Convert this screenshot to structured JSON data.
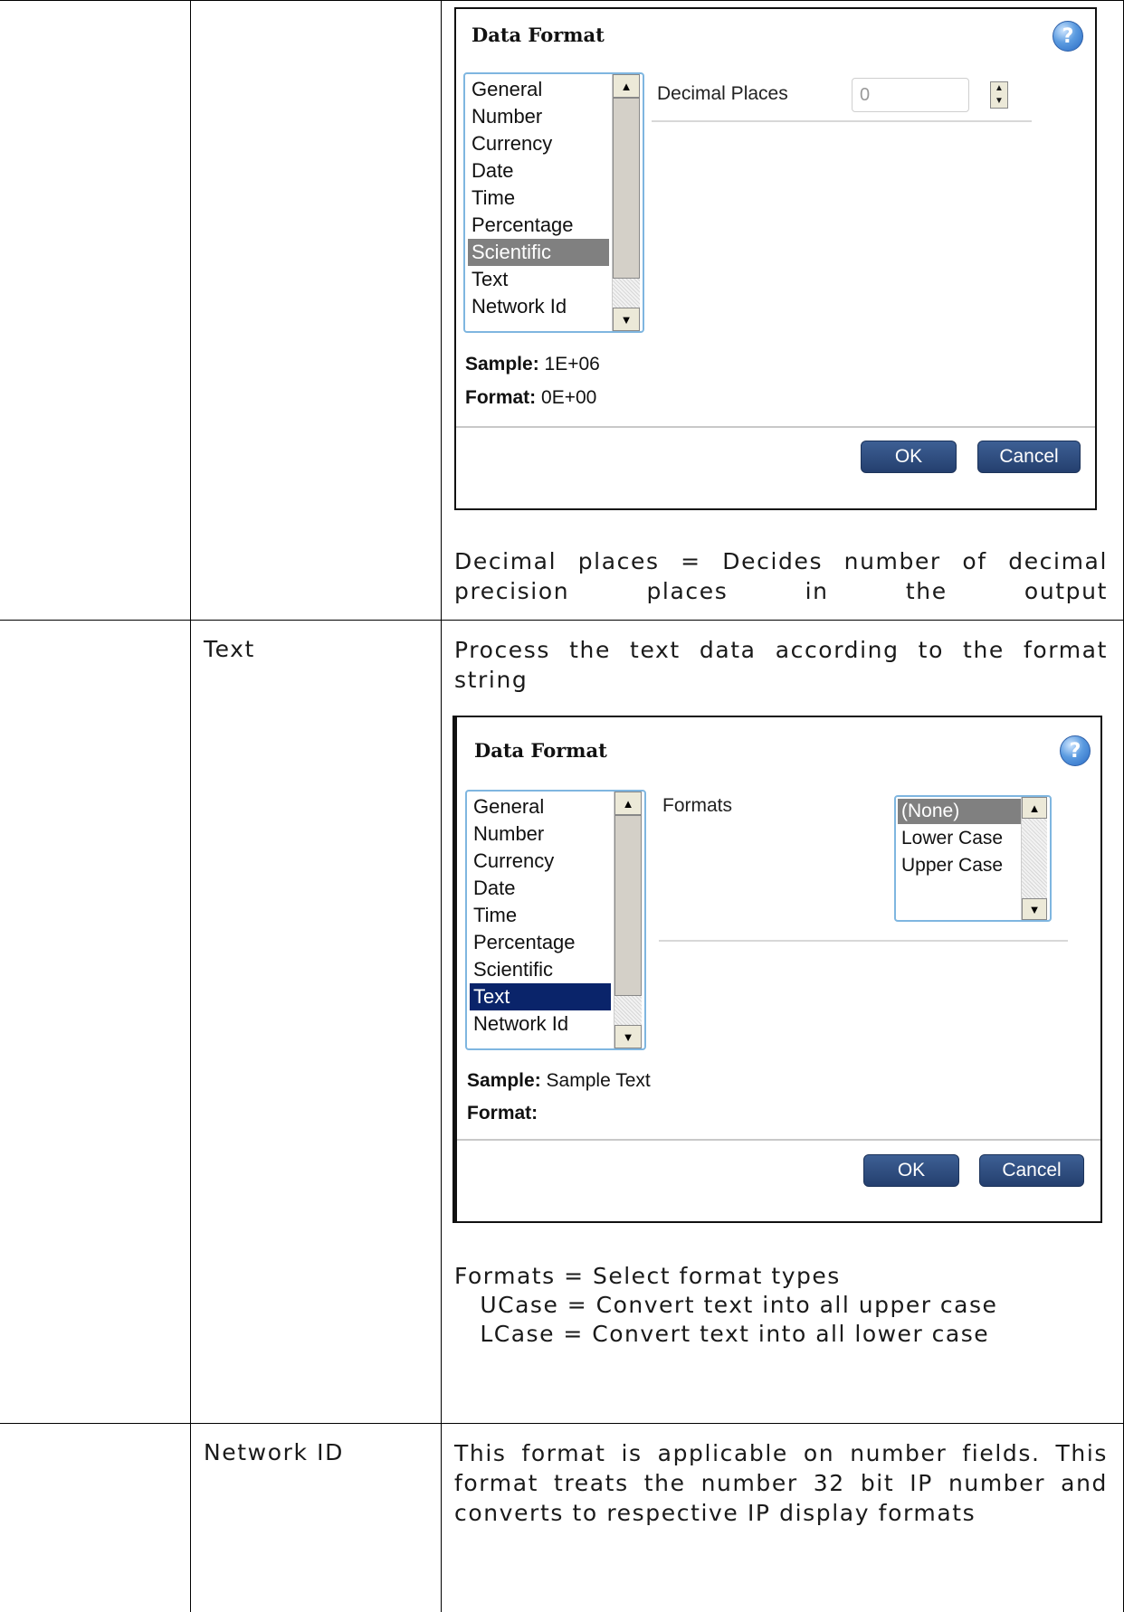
{
  "row1": {
    "dialog": {
      "title": "Data Format",
      "help_icon": "question-mark-icon",
      "list_items": [
        "General",
        "Number",
        "Currency",
        "Date",
        "Time",
        "Percentage",
        "Scientific",
        "Text",
        "Network Id"
      ],
      "selected": "Scientific",
      "decimal_label": "Decimal Places",
      "decimal_value": "0",
      "sample_label": "Sample:",
      "sample_value": "1E+06",
      "format_label": "Format:",
      "format_value": "0E+00",
      "ok": "OK",
      "cancel": "Cancel"
    },
    "description": "Decimal places = Decides number of decimal precision places in the output"
  },
  "row2": {
    "name": "Text",
    "description": "Process the text data according to the format string",
    "dialog": {
      "title": "Data Format",
      "help_icon": "question-mark-icon",
      "list_items": [
        "General",
        "Number",
        "Currency",
        "Date",
        "Time",
        "Percentage",
        "Scientific",
        "Text",
        "Network Id"
      ],
      "selected": "Text",
      "formats_label": "Formats",
      "formats_options": [
        "(None)",
        "Lower Case",
        "Upper Case"
      ],
      "formats_selected": "(None)",
      "sample_label": "Sample:",
      "sample_value": "Sample Text",
      "format_label": "Format:",
      "format_value": "",
      "ok": "OK",
      "cancel": "Cancel"
    },
    "notes": [
      "Formats = Select format types",
      "   UCase = Convert text into all upper case",
      "   LCase = Convert text into all lower case"
    ]
  },
  "row3": {
    "name": "Network ID",
    "description": "This format is applicable on number fields. This format treats the number 32 bit IP number and converts to respective IP display formats"
  }
}
